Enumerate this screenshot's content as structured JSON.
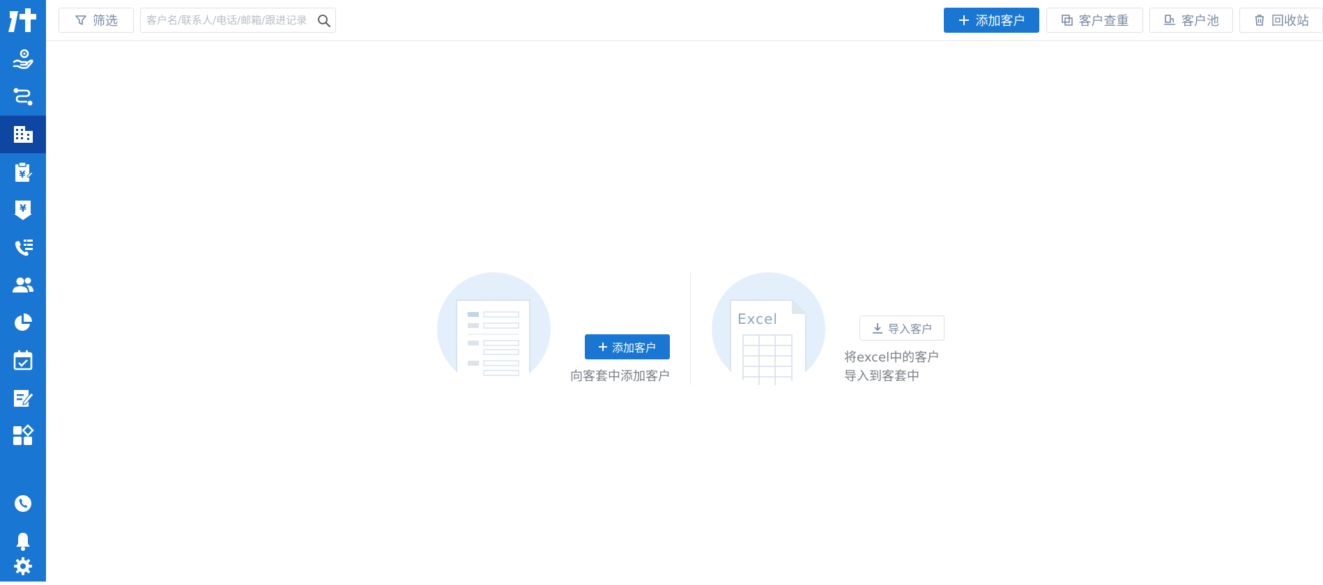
{
  "sidebar": {
    "logo_icon": "app-logo-icon",
    "items": [
      {
        "icon": "hand-coin-icon"
      },
      {
        "icon": "route-icon"
      },
      {
        "icon": "building-icon",
        "active": true
      },
      {
        "icon": "clipboard-yen-icon"
      },
      {
        "icon": "yen-download-icon"
      },
      {
        "icon": "phone-list-icon"
      },
      {
        "icon": "users-icon"
      },
      {
        "icon": "pie-chart-icon"
      },
      {
        "icon": "calendar-check-icon"
      },
      {
        "icon": "edit-note-icon"
      },
      {
        "icon": "apps-icon"
      }
    ],
    "bottom": [
      {
        "icon": "phone-circle-icon"
      },
      {
        "icon": "bell-icon"
      },
      {
        "icon": "gear-icon"
      }
    ],
    "color": "#1976d2",
    "active_color": "#0d47a1"
  },
  "toolbar": {
    "filter_label": "筛选",
    "search_placeholder": "客户名/联系人/电话/邮箱/跟进记录",
    "add_customer_label": "添加客户",
    "dedupe_label": "客户查重",
    "pool_label": "客户池",
    "recycle_label": "回收站"
  },
  "empty_state": {
    "add": {
      "button_label": "添加客户",
      "description": "向客套中添加客户"
    },
    "import": {
      "illustration_text": "Excel",
      "button_label": "导入客户",
      "description_line1": "将excel中的客户",
      "description_line2": "导入到客套中"
    }
  }
}
